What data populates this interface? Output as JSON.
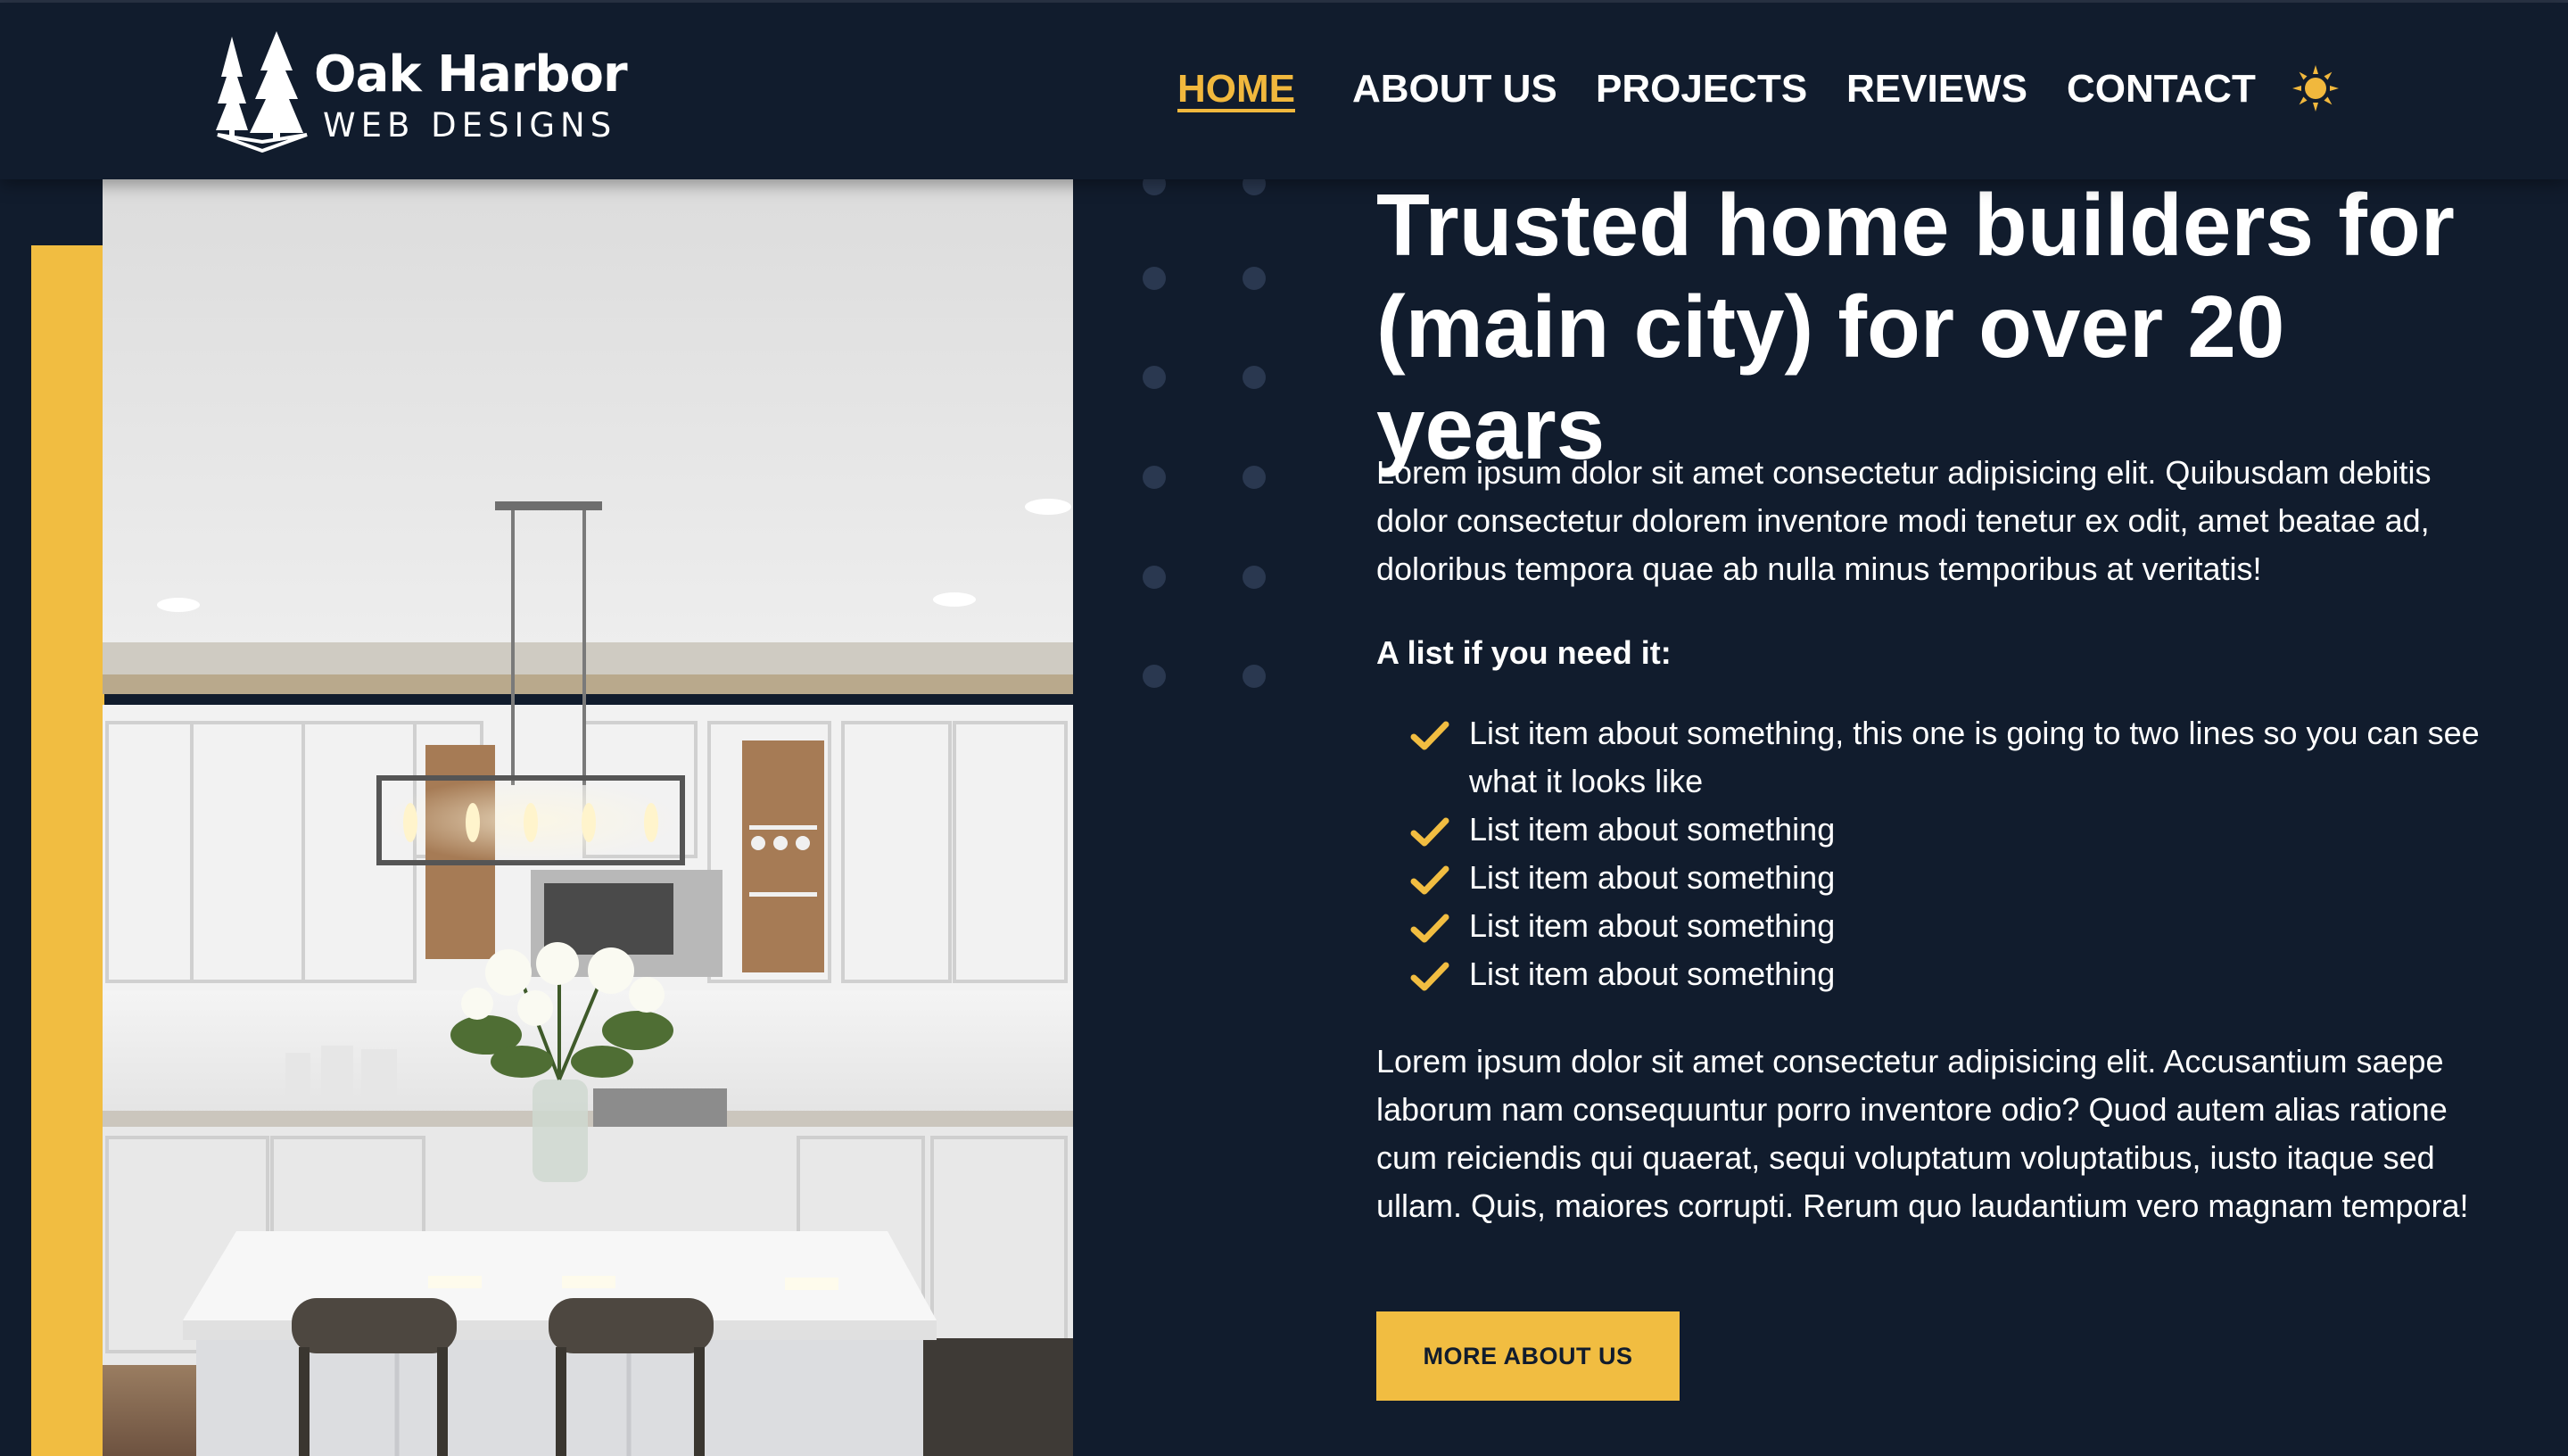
{
  "brand": {
    "name": "Oak Harbor",
    "tagline": "WEB DESIGNS"
  },
  "nav": {
    "items": [
      {
        "label": "HOME",
        "active": true
      },
      {
        "label": "ABOUT US",
        "active": false
      },
      {
        "label": "PROJECTS",
        "active": false
      },
      {
        "label": "REVIEWS",
        "active": false
      },
      {
        "label": "CONTACT",
        "active": false
      }
    ],
    "theme_toggle_icon": "sun-icon"
  },
  "hero": {
    "image_alt": "kitchen-photo",
    "headline": "Trusted home builders for (main city) for over 20 years",
    "paragraph_1": "Lorem ipsum dolor sit amet consectetur adipisicing elit. Quibusdam debitis dolor consectetur dolorem inventore modi tenetur ex odit, amet beatae ad, doloribus tempora quae ab nulla minus temporibus at veritatis!",
    "list_heading": "A list if you need it:",
    "list_items": [
      "List item about something, this one is going to two lines so you can see what it looks like",
      "List item about something",
      "List item about something",
      "List item about something",
      "List item about something"
    ],
    "list_icon": "check-icon",
    "paragraph_2": "Lorem ipsum dolor sit amet consectetur adipisicing elit. Accusantium saepe laborum nam consequuntur porro inventore odio? Quod autem alias ratione cum reiciendis qui quaerat, sequi voluptatum voluptatibus, iusto itaque sed ullam. Quis, maiores corrupti. Rerum quo laudantium vero magnam tempora!",
    "cta_label": "MORE ABOUT US"
  },
  "colors": {
    "background": "#111c2d",
    "accent": "#f1bd41",
    "text": "#ffffff",
    "dots": "#2c3a50"
  }
}
